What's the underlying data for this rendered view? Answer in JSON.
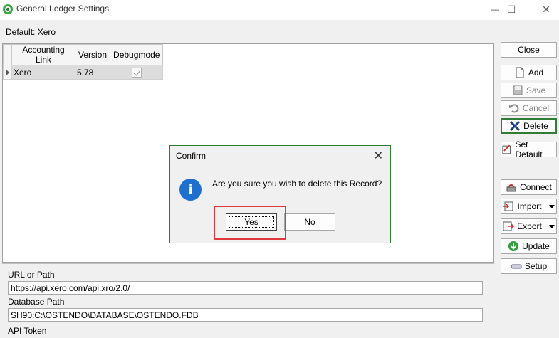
{
  "window": {
    "title": "General Ledger Settings",
    "minimize_glyph": "—",
    "maximize_glyph": "☐",
    "close_glyph": "✕"
  },
  "default_label": "Default: Xero",
  "grid": {
    "columns": [
      "Accounting Link",
      "Version",
      "Debugmode"
    ],
    "rows": [
      {
        "accounting_link": "Xero",
        "version": "5.78",
        "debugmode": true
      }
    ]
  },
  "fields": {
    "url_label": "URL or Path",
    "url_value": "https://api.xero.com/api.xro/2.0/",
    "db_label": "Database Path",
    "db_value": "SH90:C:\\OSTENDO\\DATABASE\\OSTENDO.FDB",
    "token_label": "API Token"
  },
  "side_buttons": {
    "close": "Close",
    "add": "Add",
    "save": "Save",
    "cancel": "Cancel",
    "delete": "Delete",
    "set_default": "Set Default",
    "connect": "Connect",
    "import": "Import",
    "export": "Export",
    "update": "Update",
    "setup": "Setup"
  },
  "dialog": {
    "title": "Confirm",
    "close_glyph": "✕",
    "icon_glyph": "i",
    "message": "Are you sure you wish to delete this Record?",
    "yes_label": "Yes",
    "no_label": "No"
  },
  "colors": {
    "dialog_border": "#2f7d32",
    "highlight": "#e0393e",
    "info_icon": "#1f6fd0"
  }
}
